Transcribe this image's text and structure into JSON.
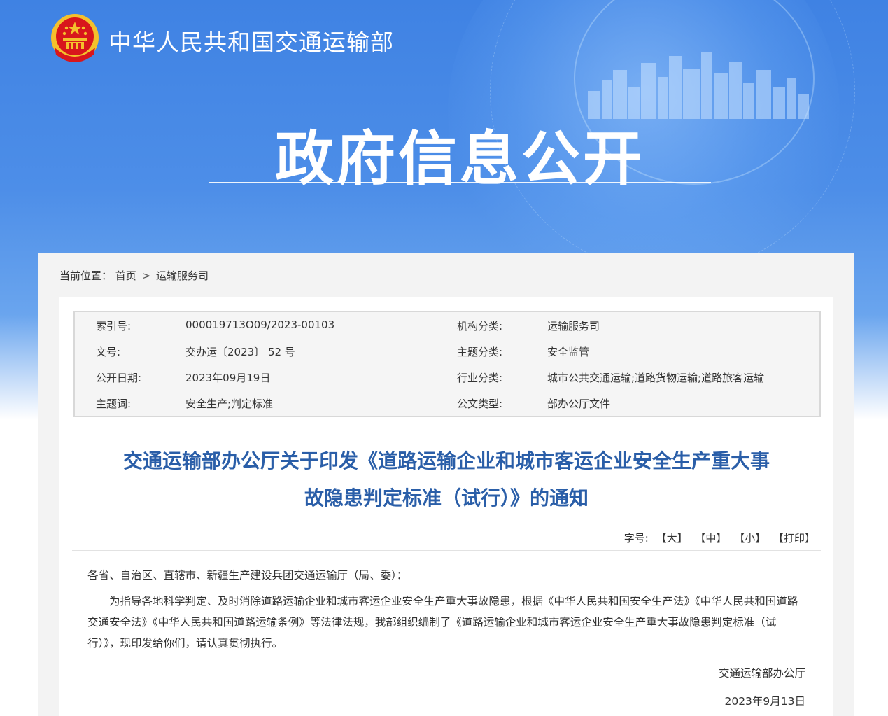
{
  "header": {
    "ministry_name": "中华人民共和国交通运输部",
    "section_title": "政府信息公开"
  },
  "breadcrumb": {
    "label": "当前位置：",
    "items": [
      "首页",
      "运输服务司"
    ],
    "separator": ">"
  },
  "meta": {
    "rows": [
      {
        "label1": "索引号:",
        "value1": "000019713O09/2023-00103",
        "label2": "机构分类:",
        "value2": "运输服务司"
      },
      {
        "label1": "文号:",
        "value1": "交办运〔2023〕 52 号",
        "label2": "主题分类:",
        "value2": "安全监管"
      },
      {
        "label1": "公开日期:",
        "value1": "2023年09月19日",
        "label2": "行业分类:",
        "value2": "城市公共交通运输;道路货物运输;道路旅客运输"
      },
      {
        "label1": "主题词:",
        "value1": "安全生产;判定标准",
        "label2": "公文类型:",
        "value2": "部办公厅文件"
      }
    ]
  },
  "document": {
    "title_line1": "交通运输部办公厅关于印发《道路运输企业和城市客运企业安全生产重大事",
    "title_line2": "故隐患判定标准（试行）》的通知",
    "fontsize_label": "字号:",
    "fontsize_large": "【大】",
    "fontsize_medium": "【中】",
    "fontsize_small": "【小】",
    "print": "【打印】",
    "salutation": "各省、自治区、直辖市、新疆生产建设兵团交通运输厅（局、委）：",
    "paragraph": "为指导各地科学判定、及时消除道路运输企业和城市客运企业安全生产重大事故隐患，根据《中华人民共和国安全生产法》《中华人民共和国道路交通安全法》《中华人民共和国道路运输条例》等法律法规，我部组织编制了《道路运输企业和城市客运企业安全生产重大事故隐患判定标准（试行）》，现印发给你们，请认真贯彻执行。",
    "signature": "交通运输部办公厅",
    "date": "2023年9月13日"
  },
  "colors": {
    "banner_blue": "#3f82e3",
    "title_blue": "#2a5ea8",
    "emblem_red": "#d8161c",
    "emblem_gold": "#f4c12c"
  }
}
